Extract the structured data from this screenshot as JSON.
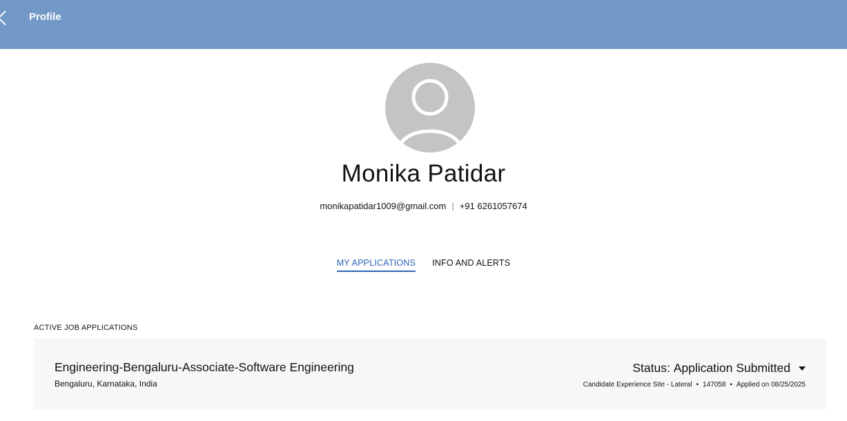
{
  "header": {
    "title": "Profile",
    "back_icon": "chevron-left-icon",
    "background": "#7198c6"
  },
  "profile": {
    "name": "Monika Patidar",
    "email": "monikapatidar1009@gmail.com",
    "separator": "|",
    "phone": "+91 6261057674",
    "avatar_icon": "user-avatar-icon"
  },
  "tabs": [
    {
      "label": "MY APPLICATIONS",
      "active": true
    },
    {
      "label": "INFO AND ALERTS",
      "active": false
    }
  ],
  "accent_color": "#2b65b5",
  "applications": {
    "heading": "ACTIVE JOB APPLICATIONS",
    "items": [
      {
        "title": "Engineering-Bengaluru-Associate-Software Engineering",
        "location": "Bengaluru, Karnataka, India",
        "status_label": "Status:",
        "status_value": "Application Submitted",
        "source": "Candidate Experience Site - Lateral",
        "job_id": "147058",
        "applied": "Applied on 08/25/2025",
        "bullet": "•"
      }
    ]
  }
}
